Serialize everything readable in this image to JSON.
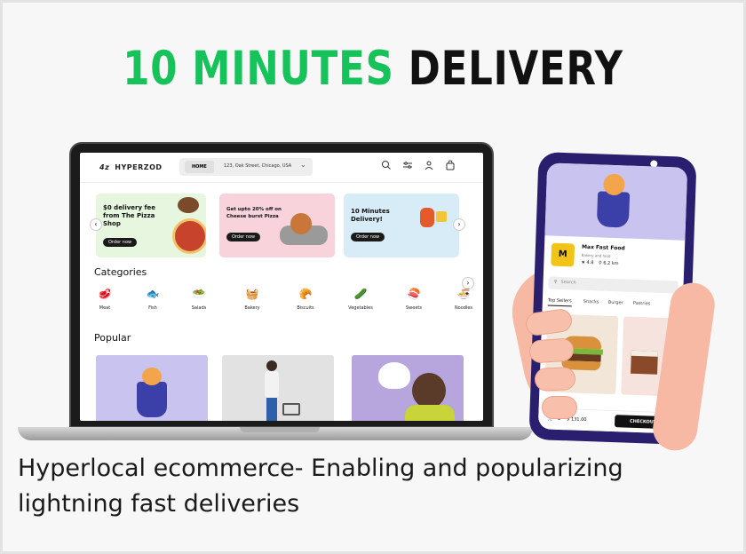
{
  "headline": {
    "green": "10 MINUTES",
    "black": "DELIVERY"
  },
  "caption": "Hyperlocal ecommerce- Enabling and popularizing lightning fast deliveries",
  "laptop": {
    "logo_mark": "4z",
    "logo_text": "HYPERZOD",
    "nav_home": "HOME",
    "address": "123, Oak Street, Chicago, USA",
    "icons": [
      "search-icon",
      "sliders-icon",
      "user-icon",
      "bag-icon"
    ],
    "banners": [
      {
        "title": "$0 delivery fee from The Pizza Shop",
        "button": "Order now",
        "bg": "#e6f6df"
      },
      {
        "title": "Get upto 20% off on Cheese burst Pizza",
        "button": "Order now",
        "bg": "#f9d3dc"
      },
      {
        "title": "10 Minutes Delivery!",
        "button": "Order now",
        "bg": "#d8ecf8"
      }
    ],
    "categories_title": "Categories",
    "categories": [
      {
        "label": "Meat",
        "icon": "🥩"
      },
      {
        "label": "Fish",
        "icon": "🐟"
      },
      {
        "label": "Salads",
        "icon": "🥗"
      },
      {
        "label": "Bakery",
        "icon": "🧺"
      },
      {
        "label": "Biscuits",
        "icon": "🥐"
      },
      {
        "label": "Vegetables",
        "icon": "🥒"
      },
      {
        "label": "Sweets",
        "icon": "🍣"
      },
      {
        "label": "Noodles",
        "icon": "🍜"
      }
    ],
    "popular_title": "Popular"
  },
  "phone": {
    "store_name": "Max Fast Food",
    "store_sub": "Bakery and food",
    "rating": "4.8",
    "distance": "6.2 km",
    "search_placeholder": "Search",
    "tabs": [
      "Top Sellers",
      "Snacks",
      "Burger",
      "Pastries"
    ],
    "cart_count": "2",
    "cart_total": "$ 131.00",
    "checkout": "CHECKOUT"
  },
  "colors": {
    "accent_green": "#16c25a",
    "phone_frame": "#2a1f6f",
    "promo_purple": "#c9c3ef"
  }
}
